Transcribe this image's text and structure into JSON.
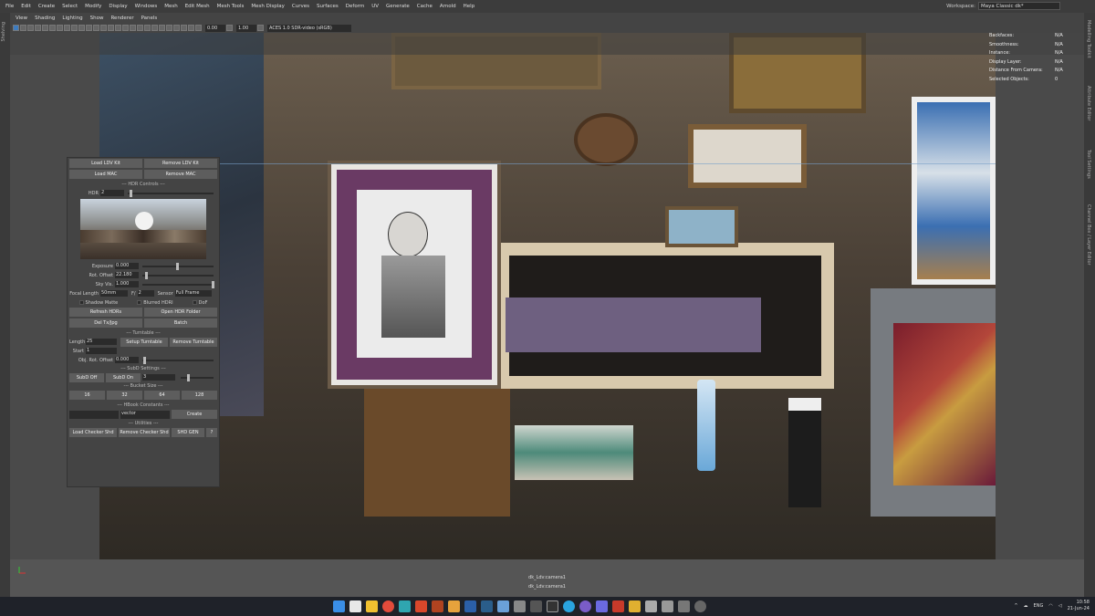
{
  "menubar": {
    "items": [
      "File",
      "Edit",
      "Create",
      "Select",
      "Modify",
      "Display",
      "Windows",
      "Mesh",
      "Edit Mesh",
      "Mesh Tools",
      "Mesh Display",
      "Curves",
      "Surfaces",
      "Deform",
      "UV",
      "Generate",
      "Cache",
      "Arnold",
      "Help"
    ],
    "workspace_label": "Workspace:",
    "workspace_value": "Maya Classic dk*"
  },
  "left_strip_label": "Shelving",
  "right_strip_labels": [
    "Modelling Toolkit",
    "Attribute Editor",
    "Tool Settings",
    "Channel Box / Layer Editor"
  ],
  "panel_menu": [
    "View",
    "Shading",
    "Lighting",
    "Show",
    "Renderer",
    "Panels"
  ],
  "toolbar": {
    "field1": "0.00",
    "field2": "1.00",
    "colorspace": "ACES 1.0 SDR-video (sRGB)"
  },
  "hud": [
    {
      "label": "Backfaces:",
      "value": "N/A"
    },
    {
      "label": "Smoothness:",
      "value": "N/A"
    },
    {
      "label": "Instance:",
      "value": "N/A"
    },
    {
      "label": "Display Layer:",
      "value": "N/A"
    },
    {
      "label": "Distance From Camera:",
      "value": "N/A"
    },
    {
      "label": "Selected Objects:",
      "value": "0"
    }
  ],
  "camera_label": "dk_Ldv:camera1",
  "panel": {
    "load_ldv": "Load LDV Kit",
    "remove_ldv": "Remove LDV Kit",
    "load_mac": "Load MAC",
    "remove_mac": "Remove MAC",
    "hdr_controls": "--- HDR Controls ---",
    "hdr_label": "HDR",
    "hdr_value": "2",
    "exposure_label": "Exposure",
    "exposure_value": "0.000",
    "rot_offset_label": "Rot. Offset",
    "rot_offset_value": "22.180",
    "sky_vis_label": "Sky Vis.",
    "sky_vis_value": "1.000",
    "focal_label": "Focal Length",
    "focal_value": "50mm",
    "fstop_label": "F/",
    "fstop_value": "2",
    "sensor_label": "Sensor",
    "sensor_value": "Full Frame",
    "shadow_matte": "Shadow Matte",
    "blurred_hdri": "Blurred HDRI",
    "dof": "DoF",
    "refresh_hdrs": "Refresh HDRs",
    "open_hdr_folder": "Open HDR Folder",
    "del_tx": "Del Tx/Jpg",
    "batch": "Batch",
    "turntable": "--- Turntable ---",
    "length_label": "Length",
    "length_value": "25",
    "setup_turntable": "Setup Turntable",
    "remove_turntable": "Remove Turntable",
    "start_label": "Start",
    "start_value": "1",
    "obj_rot_label": "Obj. Rot. Offset",
    "obj_rot_value": "0.000",
    "subd": "--- SubD Settings ---",
    "subd_off": "SubD Off",
    "subd_on": "SubD On",
    "subd_value": "3",
    "bucket": "--- Bucket Size ---",
    "bucket_sizes": [
      "16",
      "32",
      "64",
      "128"
    ],
    "hbook": "--- HBook Constants ---",
    "hbook_type": "vector",
    "create": "Create",
    "utilities": "--- Utilities ---",
    "load_checker": "Load Checker Shd",
    "remove_checker": "Remove Checker Shd",
    "shd_gen": "SHD GEN",
    "help": "?"
  },
  "taskbar": {
    "lang": "ENG",
    "time": "10:58",
    "date": "21-Jun-24"
  },
  "colors": {
    "accent": "#3d7cc0",
    "panel_bg": "#444444",
    "taskbar": "#1f2229"
  }
}
